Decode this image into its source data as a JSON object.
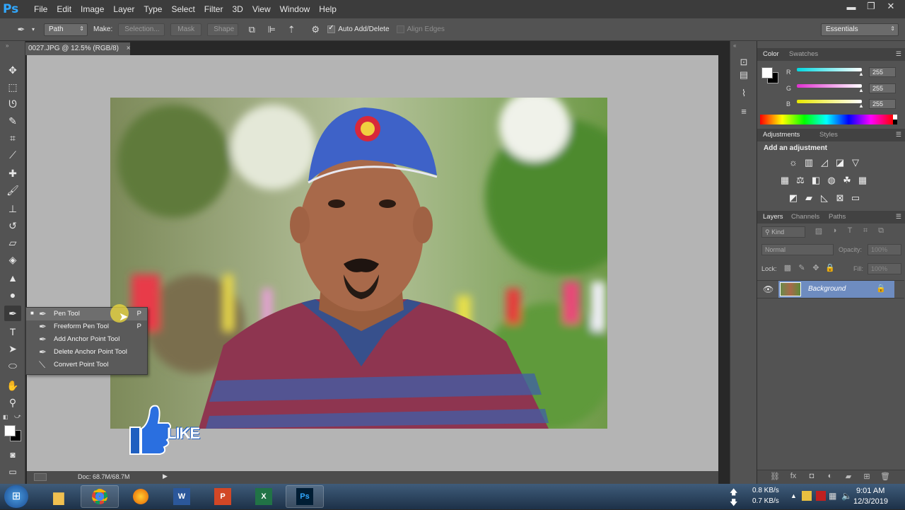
{
  "app": {
    "logo": "Ps"
  },
  "menu": [
    "File",
    "Edit",
    "Image",
    "Layer",
    "Type",
    "Select",
    "Filter",
    "3D",
    "View",
    "Window",
    "Help"
  ],
  "window_controls": {
    "minimize": "▬",
    "restore": "❐",
    "close": "✕"
  },
  "options_bar": {
    "mode": "Path",
    "make_label": "Make:",
    "selection_btn": "Selection...",
    "mask_btn": "Mask",
    "shape_btn": "Shape",
    "auto_add_delete": "Auto Add/Delete",
    "auto_add_delete_checked": true,
    "align_edges": "Align Edges",
    "align_edges_checked": false,
    "workspace": "Essentials"
  },
  "document": {
    "tab_title": "0027.JPG @ 12.5% (RGB/8)",
    "tab_close": "×",
    "status": "Doc: 68.7M/68.7M"
  },
  "pen_flyout": {
    "items": [
      {
        "label": "Pen Tool",
        "key": "P",
        "selected": true,
        "bullet": "■"
      },
      {
        "label": "Freeform Pen Tool",
        "key": "P",
        "selected": false,
        "bullet": ""
      },
      {
        "label": "Add Anchor Point Tool",
        "key": "",
        "selected": false,
        "bullet": ""
      },
      {
        "label": "Delete Anchor Point Tool",
        "key": "",
        "selected": false,
        "bullet": ""
      },
      {
        "label": "Convert Point Tool",
        "key": "",
        "selected": false,
        "bullet": ""
      }
    ]
  },
  "overlay": {
    "like_text": "LIKE"
  },
  "color_panel": {
    "tabs": [
      "Color",
      "Swatches"
    ],
    "r_label": "R",
    "r_value": "255",
    "g_label": "G",
    "g_value": "255",
    "b_label": "B",
    "b_value": "255"
  },
  "adjustments_panel": {
    "tabs": [
      "Adjustments",
      "Styles"
    ],
    "heading": "Add an adjustment"
  },
  "layers_panel": {
    "tabs": [
      "Layers",
      "Channels",
      "Paths"
    ],
    "filter_kind": "Kind",
    "blend_mode": "Normal",
    "opacity_label": "Opacity:",
    "opacity_value": "100%",
    "lock_label": "Lock:",
    "fill_label": "Fill:",
    "fill_value": "100%",
    "layers": [
      {
        "name": "Background"
      }
    ]
  },
  "taskbar": {
    "net_up": "0.8 KB/s",
    "net_down": "0.7 KB/s",
    "time": "9:01 AM",
    "date": "12/3/2019"
  },
  "colors": {
    "accent": "#31a8ff",
    "selection": "#6e8cc0",
    "r_track": "#00e8e8",
    "g_track": "#e03cd6",
    "b_track": "#e8e800"
  }
}
